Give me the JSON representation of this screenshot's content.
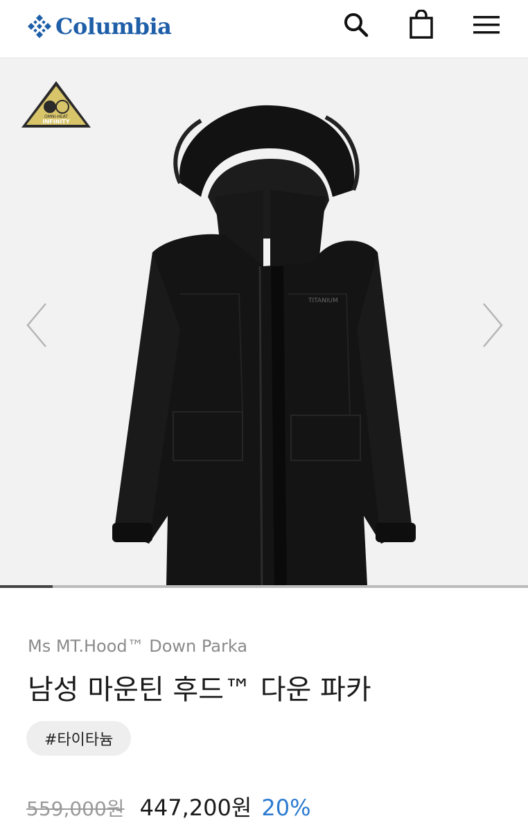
{
  "header": {
    "brand": "Columbia",
    "icons": [
      "search-icon",
      "shopping-bag-icon",
      "hamburger-menu-icon"
    ]
  },
  "gallery": {
    "badge_text": [
      "OMNI-HEAT",
      "INFINITY"
    ],
    "image_fraction_viewed": 0.1
  },
  "product": {
    "name_en": "Ms MT.Hood™ Down Parka",
    "name_ko": "남성 마운틴 후드™ 다운 파카",
    "hashtag": "#타이타늄",
    "original_price": "559,000원",
    "sale_price": "447,200원",
    "discount": "20%"
  },
  "colors": {
    "brand_blue": "#1f5fa8",
    "discount_blue": "#2b7bd0",
    "gallery_bg": "#f2f2f2"
  }
}
